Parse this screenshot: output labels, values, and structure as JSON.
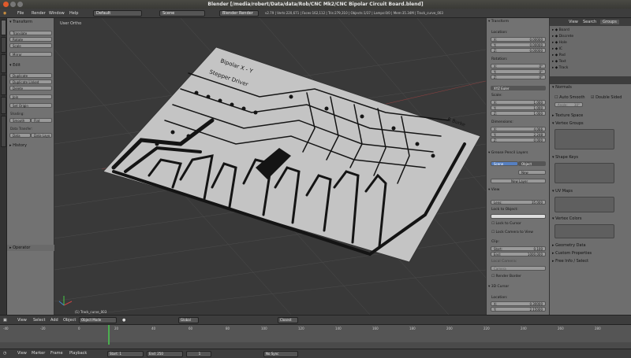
{
  "window": {
    "title": "Blender [/media/robert/Data/data/Rob/CNC Mk2/CNC Bipolar Circuit Board.blend]"
  },
  "menubar": {
    "items": [
      "File",
      "Render",
      "Window",
      "Help"
    ],
    "screen_layout": "Default",
    "scene": "Scene",
    "render_engine": "Blender Render",
    "stats": "v2.79 | Verts:220,671 | Faces:162,112 | Tris:279,310 | Objects:1/37 | Lamps:0/0 | Mem:35.34M | Track_curve_003"
  },
  "tabs": [
    "Tools",
    "Create",
    "Relations",
    "Animation",
    "Physics",
    "Grease Pencil"
  ],
  "toolshelf": {
    "transform_header": "Transform",
    "transform_buttons": [
      "Translate",
      "Rotate",
      "Scale",
      "Mirror"
    ],
    "edit_header": "Edit",
    "edit_buttons": [
      "Duplicate",
      "Duplicate Linked",
      "Delete",
      "Join"
    ],
    "set_origin": "Set Origin",
    "shading_label": "Shading:",
    "shading_buttons": [
      "Smooth",
      "Flat"
    ],
    "data_transfer_label": "Data Transfer:",
    "data_transfer_buttons": [
      "Data",
      "Data Layo"
    ],
    "history_header": "History",
    "operator_header": "Operator"
  },
  "viewport": {
    "view_label": "User Ortho",
    "object_label": "(1) Track_curve_003",
    "board_title_1": "Bipolar X - Y",
    "board_title_2": "Stepper Driver",
    "board_author": "R Burke"
  },
  "n_panel": {
    "transform_header": "Transform",
    "location_label": "Location:",
    "location": [
      {
        "n": "X:",
        "v": "0.00000"
      },
      {
        "n": "Y:",
        "v": "0.00000"
      },
      {
        "n": "Z:",
        "v": "0.00000"
      }
    ],
    "rotation_label": "Rotation:",
    "rotation": [
      {
        "n": "X:",
        "v": "0°"
      },
      {
        "n": "Y:",
        "v": "0°"
      },
      {
        "n": "Z:",
        "v": "0°"
      }
    ],
    "rotation_mode": "XYZ Euler",
    "scale_label": "Scale:",
    "scale": [
      {
        "n": "X:",
        "v": "1.000"
      },
      {
        "n": "Y:",
        "v": "1.000"
      },
      {
        "n": "Z:",
        "v": "1.000"
      }
    ],
    "dimensions_label": "Dimensions:",
    "dimensions": [
      {
        "n": "X:",
        "v": "4.066"
      },
      {
        "n": "Y:",
        "v": "2.248"
      },
      {
        "n": "Z:",
        "v": "0.000"
      }
    ],
    "grease_header": "Grease Pencil Layers",
    "grease_scene": "Scene",
    "grease_object": "Object",
    "grease_new": "New",
    "grease_new_layer": "New Layer",
    "view_header": "View",
    "lens_label": "Lens:",
    "lens_value": "35.000",
    "lock_to_object": "Lock to Object:",
    "lock_to_cursor": "Lock to Cursor",
    "lock_camera": "Lock Camera to View",
    "clip_label": "Clip:",
    "clip_start_label": "Start:",
    "clip_start": "0.100",
    "clip_end_label": "End:",
    "clip_end": "1000.000",
    "local_camera_label": "Local Camera:",
    "local_camera": "Camera",
    "render_border": "Render Border",
    "cursor_header": "3D Cursor",
    "cursor_location_label": "Location:",
    "cursor_x": "0.30000",
    "cursor_y": "2.15000"
  },
  "outliner": {
    "tabs": [
      "View",
      "Search",
      "Groups"
    ],
    "items": [
      "Board",
      "Discrete",
      "Hole",
      "IC",
      "Pad",
      "Text",
      "Track"
    ]
  },
  "properties": {
    "sections": [
      "Normals",
      "Texture Space",
      "Vertex Groups",
      "Shape Keys",
      "UV Maps",
      "Vertex Colors",
      "Geometry Data",
      "Custom Properties",
      "Free Info / Select"
    ],
    "auto_smooth": "Auto Smooth",
    "double_sided": "Double Sided",
    "angle_label": "Angle:",
    "angle_value": "30°"
  },
  "view_header": {
    "items": [
      "View",
      "Select",
      "Add",
      "Object"
    ],
    "mode": "Object Mode",
    "pivot": "Global",
    "snap": "Closest"
  },
  "timeline": {
    "ticks": [
      "-40",
      "-20",
      "0",
      "20",
      "40",
      "60",
      "80",
      "100",
      "120",
      "140",
      "160",
      "180",
      "200",
      "220",
      "240",
      "260",
      "280"
    ],
    "menus": [
      "View",
      "Marker",
      "Frame",
      "Playback"
    ],
    "start_label": "Start:",
    "start": "1",
    "end_label": "End:",
    "end": "250",
    "current": "1",
    "sync": "No Sync"
  },
  "colors": {
    "accent": "#5680c2",
    "playhead": "#4caf50",
    "pcb": "#141414"
  }
}
